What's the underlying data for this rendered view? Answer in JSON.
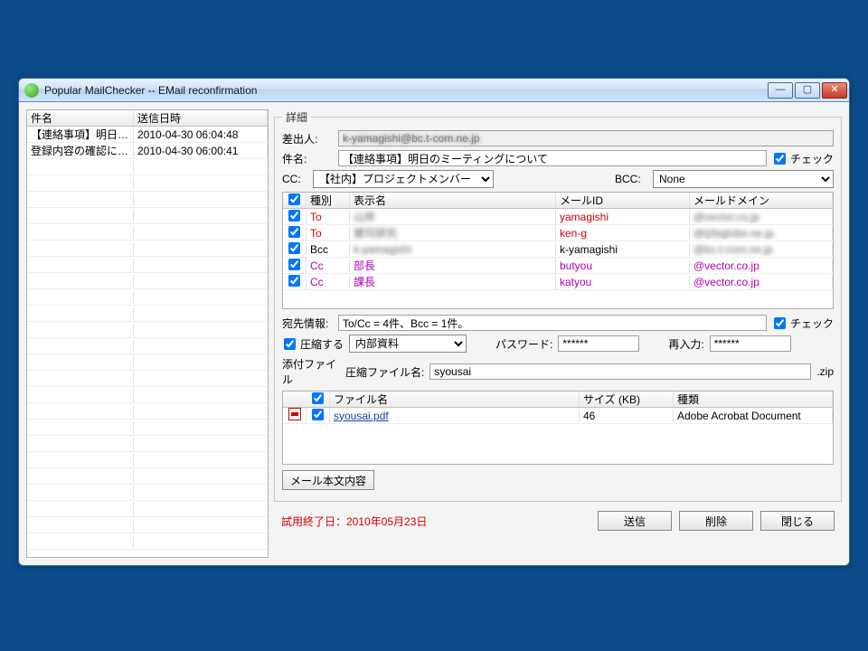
{
  "window": {
    "title": "Popular MailChecker -- EMail reconfirmation"
  },
  "messageList": {
    "cols": {
      "subject": "件名",
      "date": "送信日時"
    },
    "rows": [
      {
        "subject": "【連絡事項】明日のミ…",
        "date": "2010-04-30 06:04:48"
      },
      {
        "subject": "登録内容の確認につ…",
        "date": "2010-04-30 06:00:41"
      }
    ]
  },
  "detail": {
    "legend": "詳細",
    "fromLabel": "差出人:",
    "fromValue": "k-yamagishi@bc.t-com.ne.jp",
    "subjectLabel": "件名:",
    "subjectValue": "【連絡事項】明日のミーティングについて",
    "checkLabel": "チェック",
    "ccLabel": "CC:",
    "ccValue": "【社内】プロジェクトメンバー",
    "bccLabel": "BCC:",
    "bccValue": "None"
  },
  "recipTable": {
    "head": {
      "kind": "種別",
      "name": "表示名",
      "id": "メールID",
      "dom": "メールドメイン"
    },
    "rows": [
      {
        "kind": "To",
        "cls": "kind-to",
        "name": "山岸",
        "nameBlur": true,
        "id": "yamagishi",
        "dom": "@vector.co.jp",
        "domBlur": true
      },
      {
        "kind": "To",
        "cls": "kind-to",
        "name": "健司研究",
        "nameBlur": true,
        "id": "ken-g",
        "dom": "@ij/biglobe.ne.jp",
        "domBlur": true
      },
      {
        "kind": "Bcc",
        "cls": "",
        "name": "k-yamagishi",
        "nameBlur": true,
        "id": "k-yamagishi",
        "dom": "@bc.t-com.ne.jp",
        "domBlur": true
      },
      {
        "kind": "Cc",
        "cls": "kind-cc",
        "name": "部長",
        "nameBlur": false,
        "id": "butyou",
        "dom": "@vector.co.jp",
        "domBlur": false
      },
      {
        "kind": "Cc",
        "cls": "kind-cc",
        "name": "課長",
        "nameBlur": false,
        "id": "katyou",
        "dom": "@vector.co.jp",
        "domBlur": false
      }
    ]
  },
  "destInfo": {
    "label": "宛先情報:",
    "value": "To/Cc = 4件、Bcc = 1件。",
    "checkLabel": "チェック"
  },
  "compress": {
    "label": "圧縮する",
    "preset": "内部資料",
    "pwdLabel": "パスワード:",
    "pwdValue": "******",
    "pwd2Label": "再入力:",
    "pwd2Value": "******"
  },
  "attach": {
    "label": "添付ファイル",
    "zipNameLabel": "圧縮ファイル名:",
    "zipName": "syousai",
    "zipExt": ".zip",
    "head": {
      "name": "ファイル名",
      "size": "サイズ (KB)",
      "type": "種類"
    },
    "rows": [
      {
        "name": "syousai.pdf",
        "size": "46",
        "type": "Adobe Acrobat Document"
      }
    ]
  },
  "bodyBtn": "メール本文内容",
  "trial": "試用終了日：2010年05月23日",
  "buttons": {
    "send": "送信",
    "delete": "削除",
    "close": "閉じる"
  }
}
